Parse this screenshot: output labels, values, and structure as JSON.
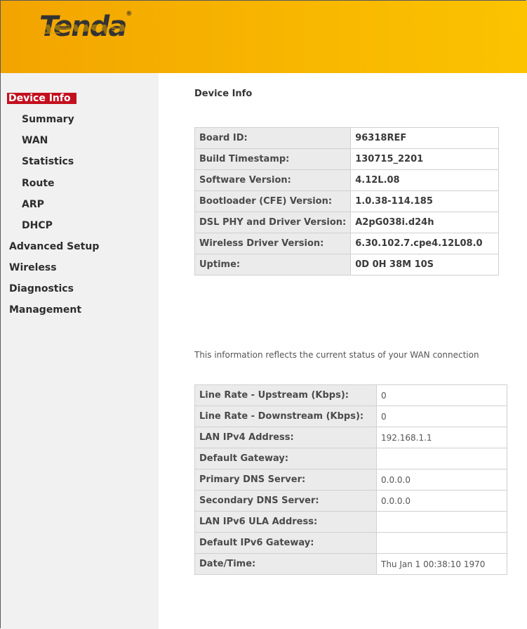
{
  "header": {
    "logo": "Tenda",
    "logo_mark": "®"
  },
  "sidebar": {
    "items": [
      {
        "label": "Device Info",
        "level": "top",
        "active": true
      },
      {
        "label": "Summary",
        "level": "sub"
      },
      {
        "label": "WAN",
        "level": "sub"
      },
      {
        "label": "Statistics",
        "level": "sub"
      },
      {
        "label": "Route",
        "level": "sub"
      },
      {
        "label": "ARP",
        "level": "sub"
      },
      {
        "label": "DHCP",
        "level": "sub"
      },
      {
        "label": "Advanced Setup",
        "level": "top"
      },
      {
        "label": "Wireless",
        "level": "top"
      },
      {
        "label": "Diagnostics",
        "level": "top"
      },
      {
        "label": "Management",
        "level": "top"
      }
    ]
  },
  "main": {
    "title": "Device Info",
    "device_table": [
      {
        "label": "Board ID:",
        "value": "96318REF"
      },
      {
        "label": "Build Timestamp:",
        "value": "130715_2201"
      },
      {
        "label": "Software Version:",
        "value": "4.12L.08"
      },
      {
        "label": "Bootloader (CFE) Version:",
        "value": "1.0.38-114.185"
      },
      {
        "label": "DSL PHY and Driver Version:",
        "value": "A2pG038i.d24h"
      },
      {
        "label": "Wireless Driver Version:",
        "value": "6.30.102.7.cpe4.12L08.0"
      },
      {
        "label": "Uptime:",
        "value": "0D 0H 38M 10S"
      }
    ],
    "wan_message": "This information reflects the current status of your WAN connection",
    "wan_table": [
      {
        "label": "Line Rate - Upstream (Kbps):",
        "value": "0"
      },
      {
        "label": "Line Rate - Downstream (Kbps):",
        "value": "0"
      },
      {
        "label": "LAN IPv4 Address:",
        "value": "192.168.1.1"
      },
      {
        "label": "Default Gateway:",
        "value": ""
      },
      {
        "label": "Primary DNS Server:",
        "value": "0.0.0.0"
      },
      {
        "label": "Secondary DNS Server:",
        "value": "0.0.0.0"
      },
      {
        "label": "LAN IPv6 ULA Address:",
        "value": ""
      },
      {
        "label": "Default IPv6 Gateway:",
        "value": ""
      },
      {
        "label": "Date/Time:",
        "value": "Thu Jan 1 00:38:10 1970"
      }
    ]
  },
  "colors": {
    "header_orange": "#f6b000",
    "active_red": "#c40f1e",
    "sidebar_bg": "#f1f1f1"
  }
}
